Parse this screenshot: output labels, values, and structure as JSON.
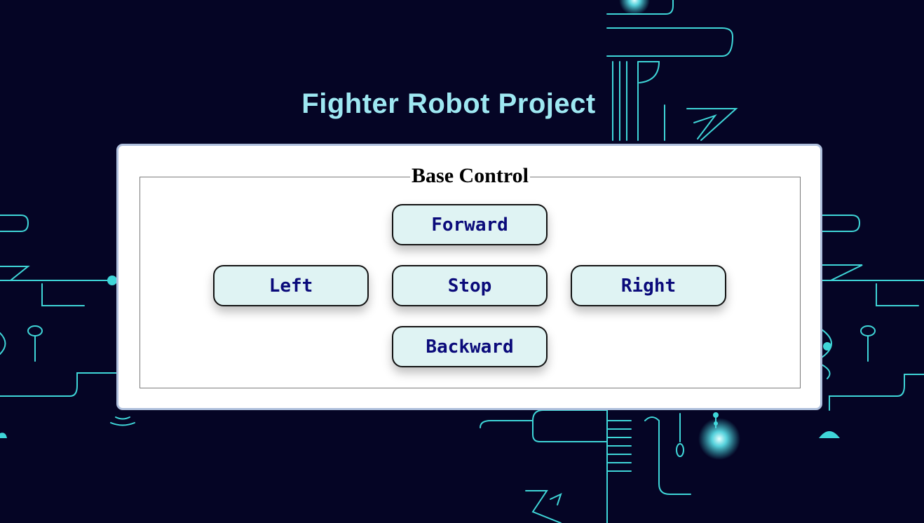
{
  "page": {
    "title": "Fighter Robot Project"
  },
  "base_control": {
    "legend": "Base Control",
    "buttons": {
      "forward": "Forward",
      "left": "Left",
      "stop": "Stop",
      "right": "Right",
      "backward": "Backward"
    }
  },
  "colors": {
    "background": "#050525",
    "circuit": "#3fd6d8",
    "title": "#9ee8f2",
    "button_fill": "#dff3f3",
    "button_text": "#0a0a7a"
  }
}
